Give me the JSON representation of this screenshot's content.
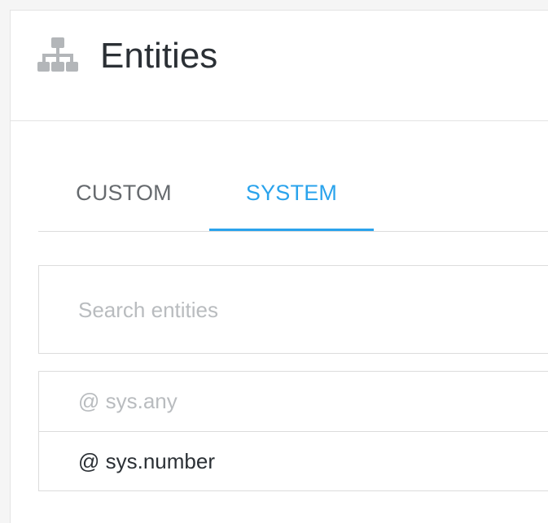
{
  "header": {
    "title": "Entities",
    "icon": "sitemap-icon",
    "icon_color": "#b3b6b9"
  },
  "tabs": [
    {
      "label": "CUSTOM",
      "active": false
    },
    {
      "label": "SYSTEM",
      "active": true
    }
  ],
  "accent_color": "#2aa3ec",
  "search": {
    "placeholder": "Search entities",
    "value": ""
  },
  "entities": [
    {
      "label": "@ sys.any",
      "state": "disabled"
    },
    {
      "label": "@ sys.number",
      "state": "enabled"
    }
  ]
}
